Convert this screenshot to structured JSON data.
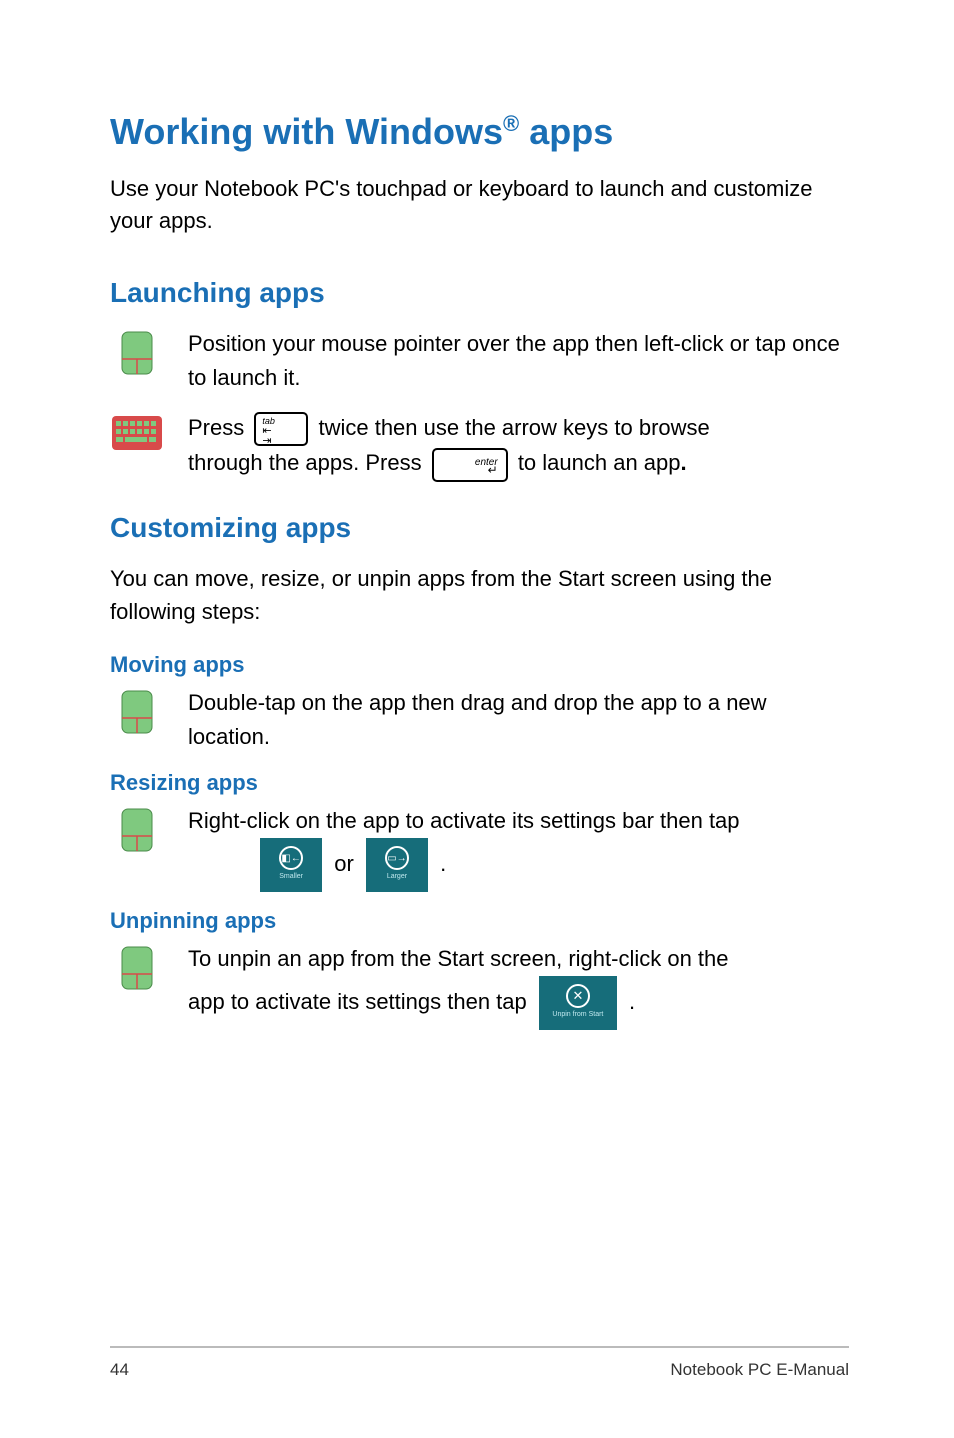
{
  "title": {
    "part1": "Working with Windows",
    "sup": "®",
    "part2": " apps"
  },
  "intro": "Use your Notebook PC's touchpad or keyboard to launch and customize your apps.",
  "launching": {
    "heading": "Launching apps",
    "mouse_text": "Position your mouse pointer over the app then left-click or tap once to launch it.",
    "kb_line1_a": "Press ",
    "kb_line1_b": " twice then use the arrow keys to browse",
    "kb_line2_a": "through the apps. Press ",
    "kb_line2_b": " to launch an app",
    "kb_period": "."
  },
  "customizing": {
    "heading": "Customizing apps",
    "intro": "You can move, resize, or unpin apps from the Start screen using the following steps:",
    "moving": {
      "heading": "Moving apps",
      "text": "Double-tap on the app then drag and drop the app to a new location."
    },
    "resizing": {
      "heading": "Resizing apps",
      "line_a": "Right-click on the app to activate its settings bar then tap",
      "or": " or ",
      "period": " ."
    },
    "unpinning": {
      "heading": "Unpinning apps",
      "line_a": "To unpin an app from the Start screen, right-click on the",
      "line_b": "app to activate its settings then tap ",
      "period": "."
    }
  },
  "tiles": {
    "smaller": "Smaller",
    "larger": "Larger",
    "unpin": "Unpin from Start"
  },
  "footer": {
    "page": "44",
    "label": "Notebook PC E-Manual"
  }
}
